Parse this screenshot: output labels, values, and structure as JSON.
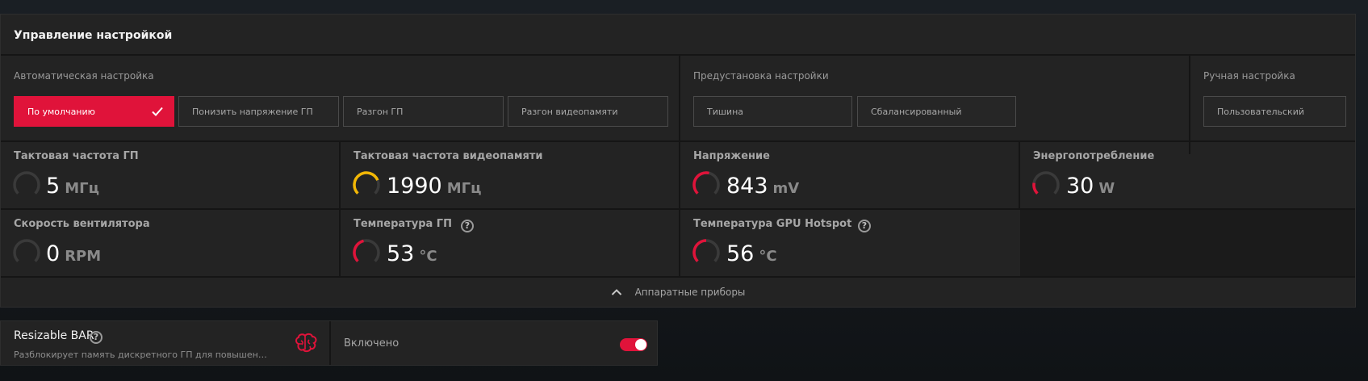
{
  "panel": {
    "title": "Управление настройкой",
    "sections": {
      "auto": "Автоматическая настройка",
      "preset": "Предустановка настройки",
      "manual": "Ручная настройка"
    },
    "auto_buttons": [
      "По умолчанию",
      "Понизить напряжение ГП",
      "Разгон ГП",
      "Разгон видеопамяти"
    ],
    "preset_buttons": [
      "Тишина",
      "Сбалансированный"
    ],
    "manual_button": "Пользовательский"
  },
  "metrics": [
    {
      "title": "Тактовая частота ГП",
      "value": "5",
      "unit": "МГц",
      "level": 0.0,
      "gauge_color": "#3a3a3a"
    },
    {
      "title": "Тактовая частота видеопамяти",
      "value": "1990",
      "unit": "МГц",
      "level": 0.75,
      "gauge_color": "#f2b705"
    },
    {
      "title": "Напряжение",
      "value": "843",
      "unit": "mV",
      "level": 0.55,
      "gauge_color": "#e0133a"
    },
    {
      "title": "Энергопотребление",
      "value": "30",
      "unit": "W",
      "level": 0.2,
      "gauge_color": "#e0133a"
    },
    {
      "title": "Скорость вентилятора",
      "value": "0",
      "unit": "RPM",
      "level": 0.0,
      "gauge_color": "#3a3a3a"
    },
    {
      "title": "Температура ГП",
      "value": "53",
      "unit": "°C",
      "level": 0.45,
      "gauge_color": "#e0133a"
    },
    {
      "title": "Температура GPU Hotspot",
      "value": "56",
      "unit": "°C",
      "level": 0.5,
      "gauge_color": "#e0133a"
    }
  ],
  "footer": {
    "label": "Аппаратные приборы"
  },
  "resizable_bar": {
    "title": "Resizable BAR",
    "description": "Разблокирует память дискретного ГП для повышения п...",
    "state": "Включено"
  },
  "colors": {
    "accent": "#e0133a",
    "warning": "#f2b705",
    "track": "#3a3a3a"
  }
}
